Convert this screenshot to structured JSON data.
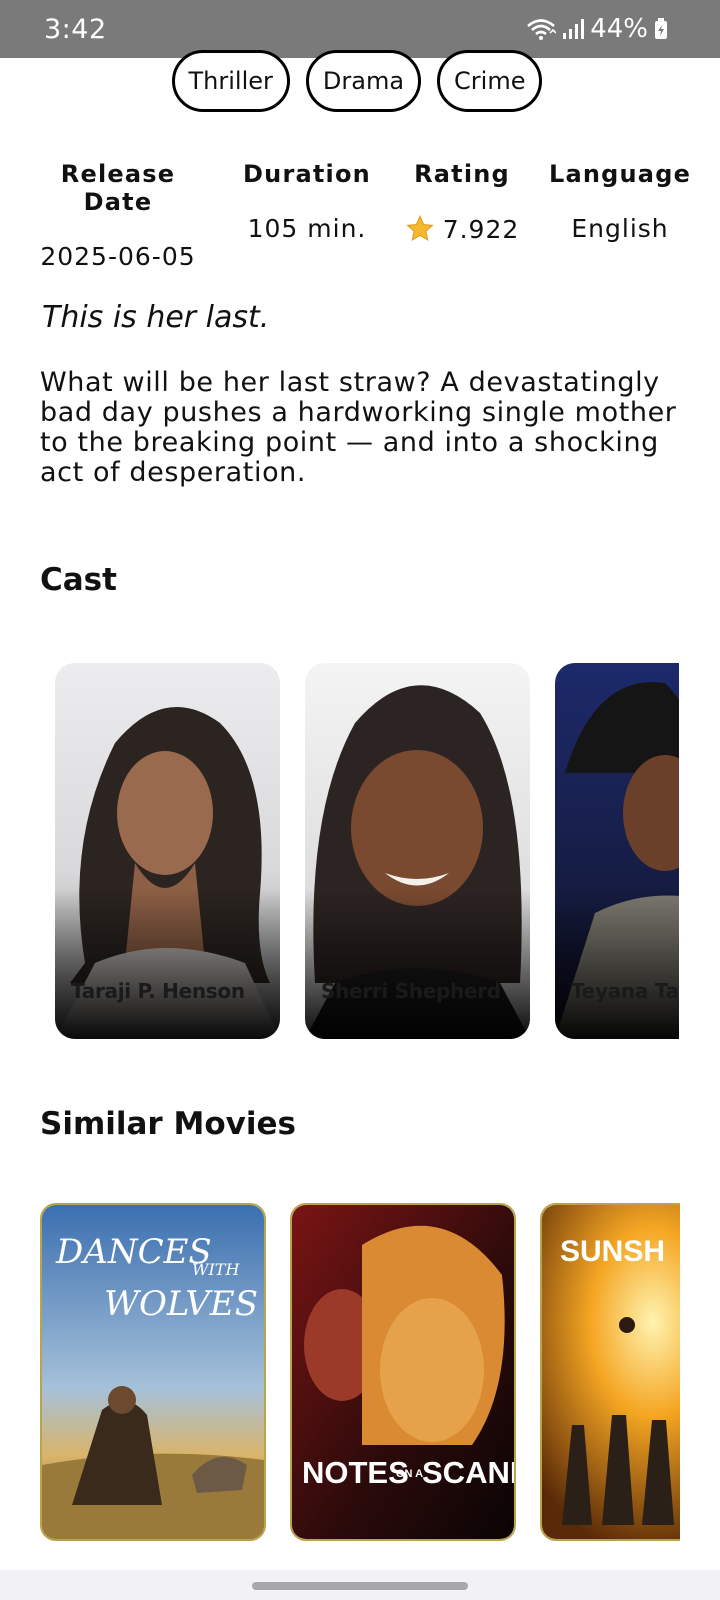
{
  "status_bar": {
    "time": "3:42",
    "battery": "44%",
    "icons": [
      "wifi-icon",
      "signal-icon",
      "battery-icon"
    ]
  },
  "genres": [
    "Thriller",
    "Drama",
    "Crime"
  ],
  "info": [
    {
      "label": "Release Date",
      "value": "2025-06-05"
    },
    {
      "label": "Duration",
      "value": "105 min."
    },
    {
      "label": "Rating",
      "value": "7.922",
      "icon": "star-icon"
    },
    {
      "label": "Language",
      "value": "English"
    }
  ],
  "tagline": "This is her last.",
  "overview": "What will be her last straw? A devastatingly bad day pushes a hardworking single mother to the breaking point — and into a shocking act of desperation.",
  "cast_title": "Cast",
  "cast": [
    {
      "name": "Taraji P. Henson"
    },
    {
      "name": "Sherri Shepherd"
    },
    {
      "name": "Teyana Taylor"
    }
  ],
  "similar_title": "Similar Movies",
  "similar": [
    {
      "title": "Dances with Wolves",
      "poster_text_a": "DANCES",
      "poster_text_b": "WITH",
      "poster_text_c": "WOLVES"
    },
    {
      "title": "Notes on a Scandal",
      "poster_text_a": "NOTES",
      "poster_text_b": "ON A",
      "poster_text_c": "SCANDAL"
    },
    {
      "title": "Sunshine",
      "poster_text_a": "SUNSH"
    }
  ],
  "colors": {
    "status_bar": "#7a7a7a",
    "chip_border": "#000000",
    "poster_border": "#b8a44a",
    "star": "#f5b82e"
  }
}
